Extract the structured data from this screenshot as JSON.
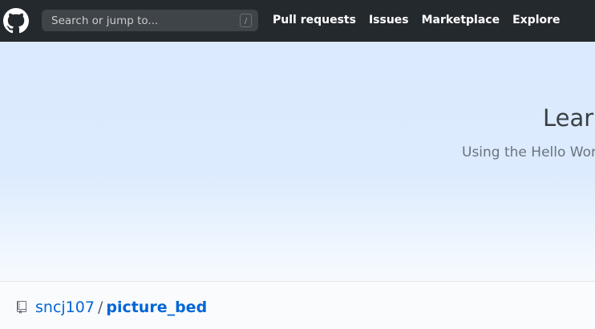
{
  "header": {
    "logo_icon": "github-octocat-icon",
    "search_placeholder": "Search or jump to...",
    "search_shortcut": "/",
    "nav": [
      {
        "label": "Pull requests"
      },
      {
        "label": "Issues"
      },
      {
        "label": "Marketplace"
      },
      {
        "label": "Explore"
      }
    ]
  },
  "hero": {
    "title": "Learn",
    "subtitle": "Using the Hello World"
  },
  "repo": {
    "icon": "repo-icon",
    "owner": "sncj107",
    "separator": "/",
    "name": "picture_bed"
  },
  "colors": {
    "header_bg": "#24292e",
    "link": "#0366d6",
    "hero_bg": "#dbeafe"
  }
}
